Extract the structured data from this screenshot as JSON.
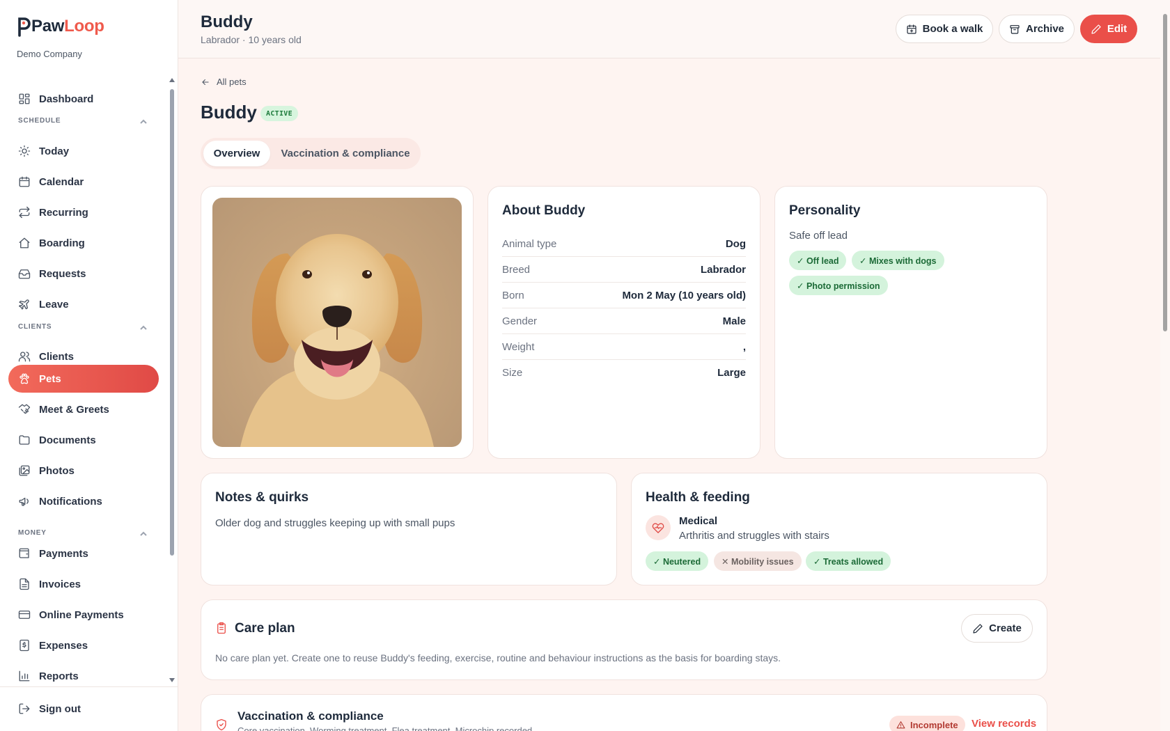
{
  "brand": {
    "name_first": "Paw",
    "name_second": "Loop",
    "company": "Demo Company"
  },
  "sidebar": {
    "items": [
      {
        "label": "Dashboard",
        "icon": "dashboard-icon"
      },
      {
        "label": "Today",
        "icon": "sun-icon"
      },
      {
        "label": "Calendar",
        "icon": "calendar-icon"
      },
      {
        "label": "Recurring",
        "icon": "repeat-icon"
      },
      {
        "label": "Boarding",
        "icon": "home-icon"
      },
      {
        "label": "Requests",
        "icon": "inbox-icon"
      },
      {
        "label": "Leave",
        "icon": "plane-icon"
      },
      {
        "label": "Clients",
        "icon": "users-icon"
      },
      {
        "label": "Pets",
        "icon": "paw-icon",
        "active": true
      },
      {
        "label": "Meet & Greets",
        "icon": "handshake-icon"
      },
      {
        "label": "Documents",
        "icon": "folder-icon"
      },
      {
        "label": "Photos",
        "icon": "images-icon"
      },
      {
        "label": "Notifications",
        "icon": "megaphone-icon"
      },
      {
        "label": "Payments",
        "icon": "wallet-icon"
      },
      {
        "label": "Invoices",
        "icon": "file-icon"
      },
      {
        "label": "Online Payments",
        "icon": "credit-card-icon"
      },
      {
        "label": "Expenses",
        "icon": "receipt-icon"
      },
      {
        "label": "Reports",
        "icon": "bar-chart-icon"
      }
    ],
    "sections": {
      "schedule": "SCHEDULE",
      "clients": "CLIENTS",
      "money": "MONEY"
    },
    "signout": "Sign out"
  },
  "header": {
    "title": "Buddy",
    "subtitle": "Labrador · 10 years old",
    "book_walk": "Book a walk",
    "archive": "Archive",
    "edit": "Edit"
  },
  "page": {
    "back": "All pets",
    "name": "Buddy",
    "status": "ACTIVE",
    "tabs": [
      "Overview",
      "Vaccination & compliance"
    ]
  },
  "about": {
    "title": "About Buddy",
    "rows": [
      {
        "key": "Animal type",
        "value": "Dog"
      },
      {
        "key": "Breed",
        "value": "Labrador"
      },
      {
        "key": "Born",
        "value": "Mon 2 May (10 years old)"
      },
      {
        "key": "Gender",
        "value": "Male"
      },
      {
        "key": "Weight",
        "value": ","
      },
      {
        "key": "Size",
        "value": "Large"
      }
    ]
  },
  "personality": {
    "title": "Personality",
    "summary": "Safe off lead",
    "chips": [
      "✓ Off lead",
      "✓ Mixes with dogs",
      "✓ Photo permission"
    ]
  },
  "notes": {
    "title": "Notes & quirks",
    "text": "Older dog and struggles keeping up with small pups"
  },
  "health": {
    "title": "Health & feeding",
    "medical_label": "Medical",
    "medical_text": "Arthritis and struggles with stairs",
    "chips": [
      {
        "label": "✓ Neutered",
        "state": "yes"
      },
      {
        "label": "✕ Mobility issues",
        "state": "no"
      },
      {
        "label": "✓ Treats allowed",
        "state": "yes"
      }
    ]
  },
  "care_plan": {
    "title": "Care plan",
    "create": "Create",
    "text": "No care plan yet. Create one to reuse Buddy's feeding, exercise, routine and behaviour instructions as the basis for boarding stays."
  },
  "vaccination": {
    "title": "Vaccination & compliance",
    "subtitle": "Core vaccination, Worming treatment, Flea treatment, Microchip recorded",
    "status": "Incomplete",
    "link": "View records"
  },
  "colors": {
    "accent": "#ea4f49",
    "success_bg": "#d4f3dc",
    "success_text": "#1b6a36",
    "page_bg": "#fef4f1"
  }
}
